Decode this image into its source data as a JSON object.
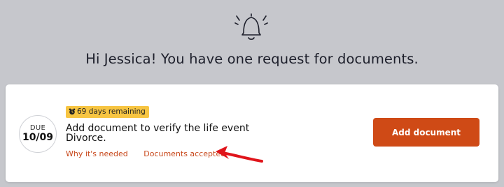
{
  "header": {
    "icon": "bell-ringing-icon",
    "greeting": "Hi Jessica! You have one request for documents."
  },
  "request": {
    "due_label": "DUE",
    "due_date": "10/09",
    "badge_icon": "alarm-clock-icon",
    "remaining": "69 days remaining",
    "title_line1": "Add document to verify the life event",
    "title_line2": "Divorce.",
    "link_why": "Why it's needed",
    "link_docs": "Documents accepted",
    "button_label": "Add document"
  },
  "colors": {
    "background": "#c6c7cc",
    "accent": "#cf4a16",
    "link": "#c8471a",
    "badge": "#f7c542",
    "annotation_arrow": "#e0151b"
  }
}
